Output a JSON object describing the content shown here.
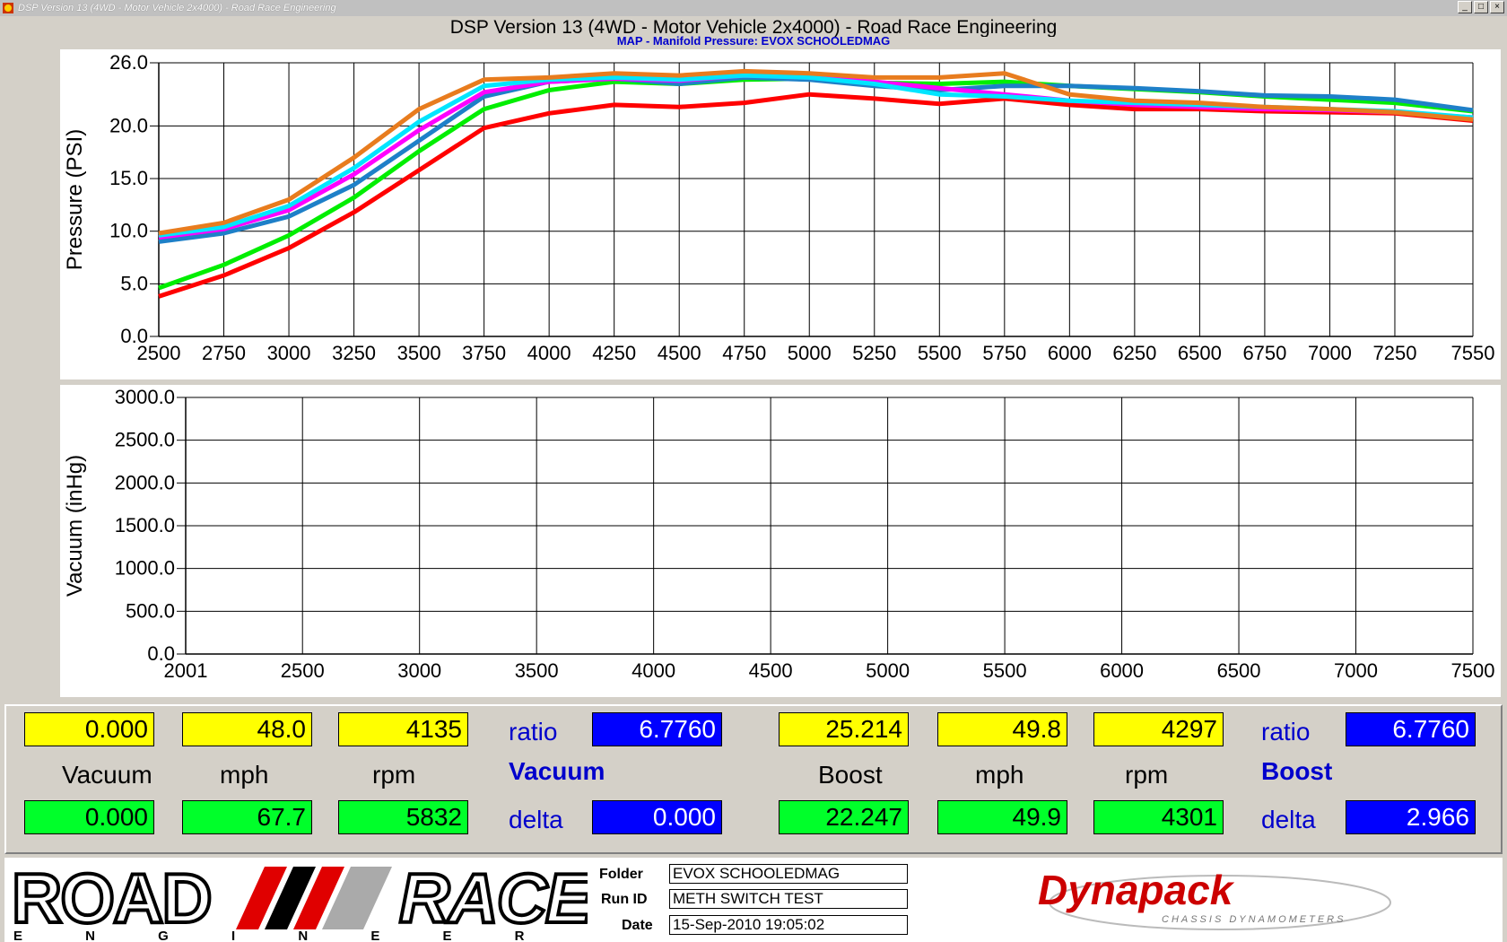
{
  "window": {
    "title": "DSP Version 13 (4WD - Motor Vehicle 2x4000) - Road Race Engineering",
    "controls": [
      "_",
      "□",
      "×"
    ]
  },
  "header": {
    "title": "DSP Version 13 (4WD - Motor Vehicle 2x4000) - Road Race Engineering",
    "subtitle": "MAP - Manifold Pressure: EVOX SCHOOLEDMAG"
  },
  "chart_data": [
    {
      "type": "line",
      "ylabel": "Pressure (PSI)",
      "xlim": [
        2500,
        7550
      ],
      "ylim": [
        0,
        26
      ],
      "x_ticks": [
        "2500",
        "2750",
        "3000",
        "3250",
        "3500",
        "3750",
        "4000",
        "4250",
        "4500",
        "4750",
        "5000",
        "5250",
        "5500",
        "5750",
        "6000",
        "6250",
        "6500",
        "6750",
        "7000",
        "7250",
        "7550"
      ],
      "y_ticks": [
        "0.0",
        "5.0",
        "10.0",
        "15.0",
        "20.0",
        "26.0"
      ],
      "grid": true,
      "series": [
        {
          "color": "#ff0000",
          "x": [
            2500,
            2750,
            3000,
            3250,
            3500,
            3750,
            4000,
            4250,
            4500,
            4750,
            5000,
            5250,
            5500,
            5750,
            6000,
            6250,
            6500,
            6750,
            7000,
            7250,
            7550
          ],
          "y": [
            3.8,
            5.8,
            8.4,
            11.8,
            15.8,
            19.8,
            21.2,
            22.0,
            21.8,
            22.2,
            23.0,
            22.6,
            22.1,
            22.6,
            22.0,
            21.6,
            21.6,
            21.4,
            21.3,
            21.2,
            20.5
          ]
        },
        {
          "color": "#00ee00",
          "x": [
            2500,
            2750,
            3000,
            3250,
            3500,
            3750,
            4000,
            4250,
            4500,
            4750,
            5000,
            5250,
            5500,
            5750,
            6000,
            6250,
            6500,
            6750,
            7000,
            7250,
            7550
          ],
          "y": [
            4.6,
            6.8,
            9.6,
            13.2,
            17.6,
            21.6,
            23.4,
            24.2,
            24.0,
            24.4,
            24.5,
            24.1,
            24.0,
            24.2,
            23.8,
            23.5,
            23.2,
            22.8,
            22.5,
            22.2,
            21.4
          ]
        },
        {
          "color": "#1e80c8",
          "x": [
            2500,
            2750,
            3000,
            3250,
            3500,
            3750,
            4000,
            4250,
            4500,
            4750,
            5000,
            5250,
            5500,
            5750,
            6000,
            6250,
            6500,
            6750,
            7000,
            7250,
            7550
          ],
          "y": [
            9.0,
            9.8,
            11.4,
            14.4,
            18.6,
            22.8,
            24.2,
            24.5,
            24.0,
            24.6,
            24.4,
            23.8,
            23.4,
            23.8,
            23.8,
            23.6,
            23.3,
            22.9,
            22.8,
            22.5,
            21.5
          ]
        },
        {
          "color": "#ff00ff",
          "x": [
            2500,
            2750,
            3000,
            3250,
            3500,
            3750,
            4000,
            4250,
            4500,
            4750,
            5000,
            5250,
            5500,
            5750,
            6000,
            6250,
            6500,
            6750,
            7000,
            7250,
            7550
          ],
          "y": [
            9.4,
            10.2,
            12.0,
            15.4,
            19.6,
            23.2,
            24.2,
            24.5,
            24.3,
            24.8,
            24.6,
            24.2,
            23.6,
            23.0,
            22.4,
            22.0,
            21.8,
            21.6,
            21.5,
            21.3,
            20.8
          ]
        },
        {
          "color": "#00e5ff",
          "x": [
            2500,
            2750,
            3000,
            3250,
            3500,
            3750,
            4000,
            4250,
            4500,
            4750,
            5000,
            5250,
            5500,
            5750,
            6000,
            6250,
            6500,
            6750,
            7000,
            7250,
            7550
          ],
          "y": [
            9.6,
            10.4,
            12.4,
            16.0,
            20.4,
            23.8,
            24.4,
            24.6,
            24.4,
            24.8,
            24.6,
            24.0,
            23.0,
            22.8,
            22.4,
            22.2,
            22.0,
            21.8,
            21.6,
            21.4,
            20.8
          ]
        },
        {
          "color": "#e87c1e",
          "x": [
            2500,
            2750,
            3000,
            3250,
            3500,
            3750,
            4000,
            4250,
            4500,
            4750,
            5000,
            5250,
            5500,
            5750,
            6000,
            6250,
            6500,
            6750,
            7000,
            7250,
            7550
          ],
          "y": [
            9.8,
            10.8,
            13.0,
            17.0,
            21.6,
            24.4,
            24.6,
            25.0,
            24.8,
            25.2,
            25.0,
            24.6,
            24.6,
            25.0,
            23.0,
            22.4,
            22.2,
            21.8,
            21.6,
            21.3,
            20.6
          ]
        }
      ]
    },
    {
      "type": "line",
      "ylabel": "Vacuum (inHg)",
      "xlim": [
        2001,
        7500
      ],
      "ylim": [
        0,
        3000
      ],
      "x_ticks": [
        "2001",
        "2500",
        "3000",
        "3500",
        "4000",
        "4500",
        "5000",
        "5500",
        "6000",
        "6500",
        "7000",
        "7500"
      ],
      "y_ticks": [
        "0.0",
        "500.0",
        "1000.0",
        "1500.0",
        "2000.0",
        "2500.0",
        "3000.0"
      ],
      "grid": true,
      "series": []
    }
  ],
  "readouts": {
    "left": {
      "top_values": [
        "0.000",
        "48.0",
        "4135"
      ],
      "bottom_values": [
        "0.000",
        "67.7",
        "5832"
      ],
      "labels": [
        "Vacuum",
        "mph",
        "rpm"
      ],
      "ratio_label": "ratio",
      "ratio_value": "6.7760",
      "mode_label": "Vacuum",
      "delta_label": "delta",
      "delta_value": "0.000"
    },
    "right": {
      "top_values": [
        "25.214",
        "49.8",
        "4297"
      ],
      "bottom_values": [
        "22.247",
        "49.9",
        "4301"
      ],
      "labels": [
        "Boost",
        "mph",
        "rpm"
      ],
      "ratio_label": "ratio",
      "ratio_value": "6.7760",
      "mode_label": "Boost",
      "delta_label": "delta",
      "delta_value": "2.966"
    }
  },
  "footer": {
    "logo_text": "ROAD",
    "logo_text2": "RACE",
    "logo_sub": "E N G I N E E R I N G",
    "folder_label": "Folder",
    "folder_value": "EVOX SCHOOLEDMAG",
    "runid_label": "Run ID",
    "runid_value": "METH SWITCH TEST",
    "date_label": "Date",
    "date_value": "15-Sep-2010 19:05:02",
    "brand": "Dynapack",
    "brand_sub": "CHASSIS DYNAMOMETERS"
  }
}
